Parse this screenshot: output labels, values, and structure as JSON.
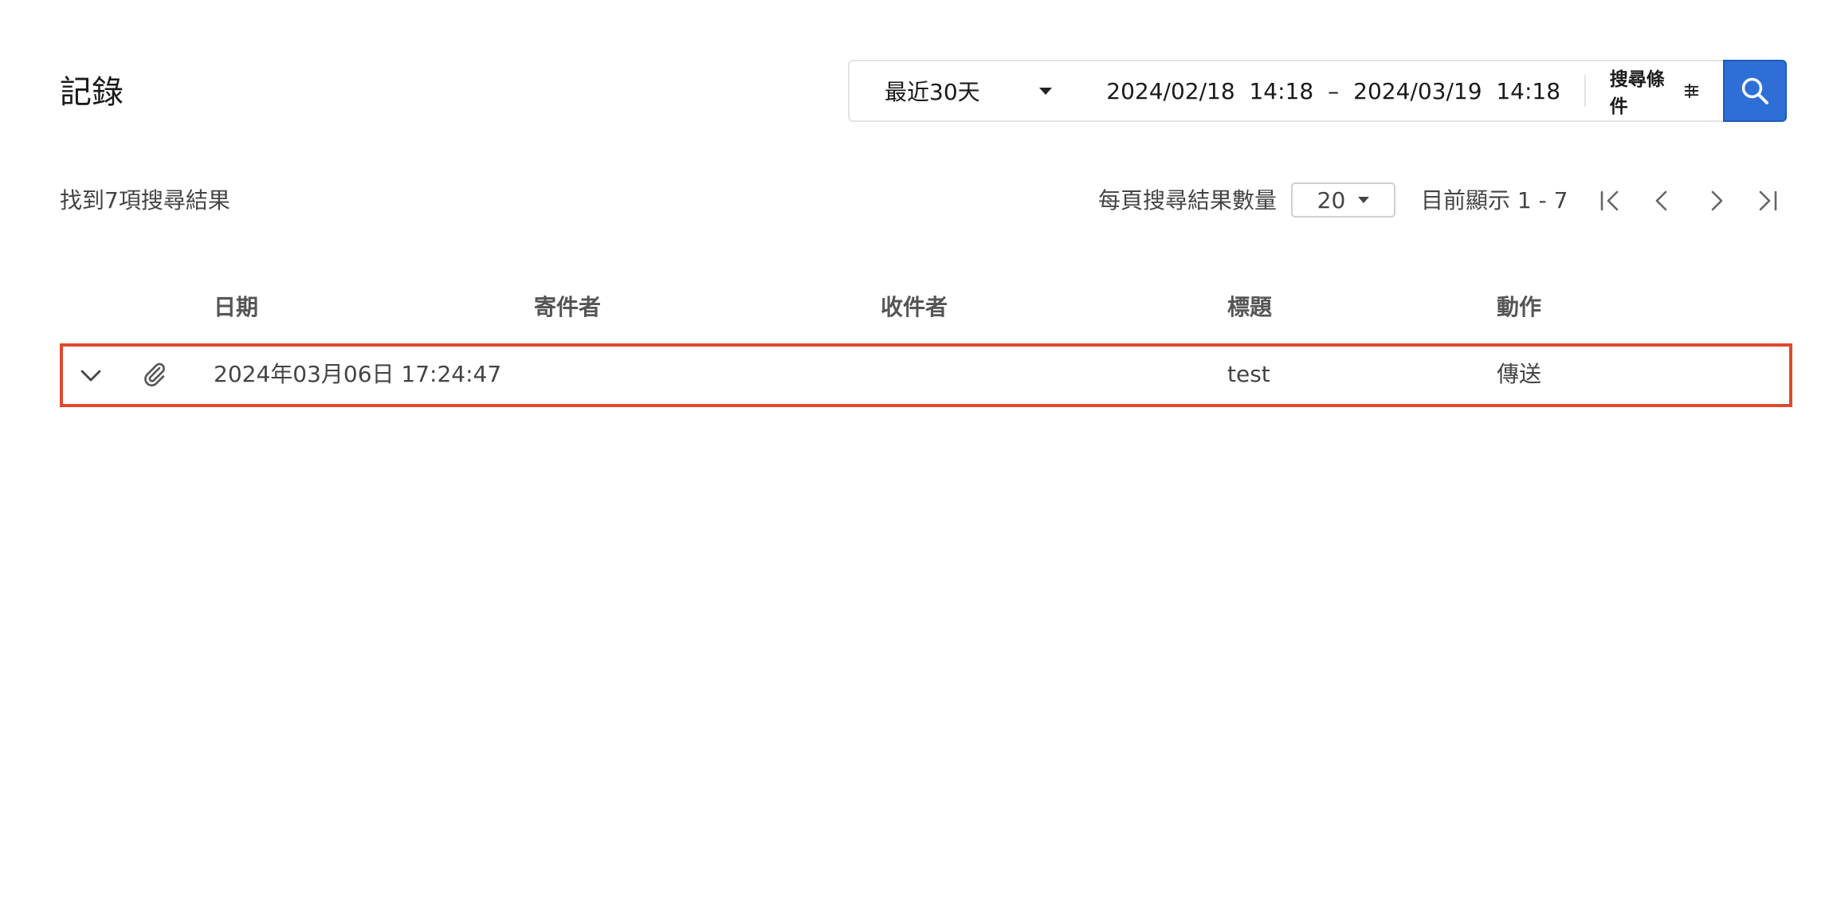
{
  "page": {
    "title": "記錄"
  },
  "search": {
    "range_label": "最近30天",
    "date_from": "2024/02/18  14:18",
    "date_separator": "–",
    "date_to": "2024/03/19  14:18",
    "filter_label": "搜尋條件",
    "accent_color": "#2d6fd6"
  },
  "results": {
    "count_text": "找到7項搜尋結果",
    "per_page_label": "每頁搜尋結果數量",
    "per_page_value": "20",
    "showing_text": "目前顯示 1 - 7"
  },
  "table": {
    "columns": {
      "date": "日期",
      "sender": "寄件者",
      "recipient": "收件者",
      "subject": "標題",
      "action": "動作"
    },
    "rows": [
      {
        "date": "2024年03月06日 17:24:47",
        "sender": "",
        "recipient": "",
        "subject": "test",
        "action": "傳送",
        "has_attachment": true,
        "highlight_color": "#e0482e"
      }
    ]
  },
  "icons": {
    "search": "search-icon",
    "filter": "sliders-icon",
    "first_page": "first-page-icon",
    "prev_page": "chevron-left-icon",
    "next_page": "chevron-right-icon",
    "last_page": "last-page-icon",
    "expand": "chevron-down-icon",
    "attachment": "paperclip-icon"
  }
}
